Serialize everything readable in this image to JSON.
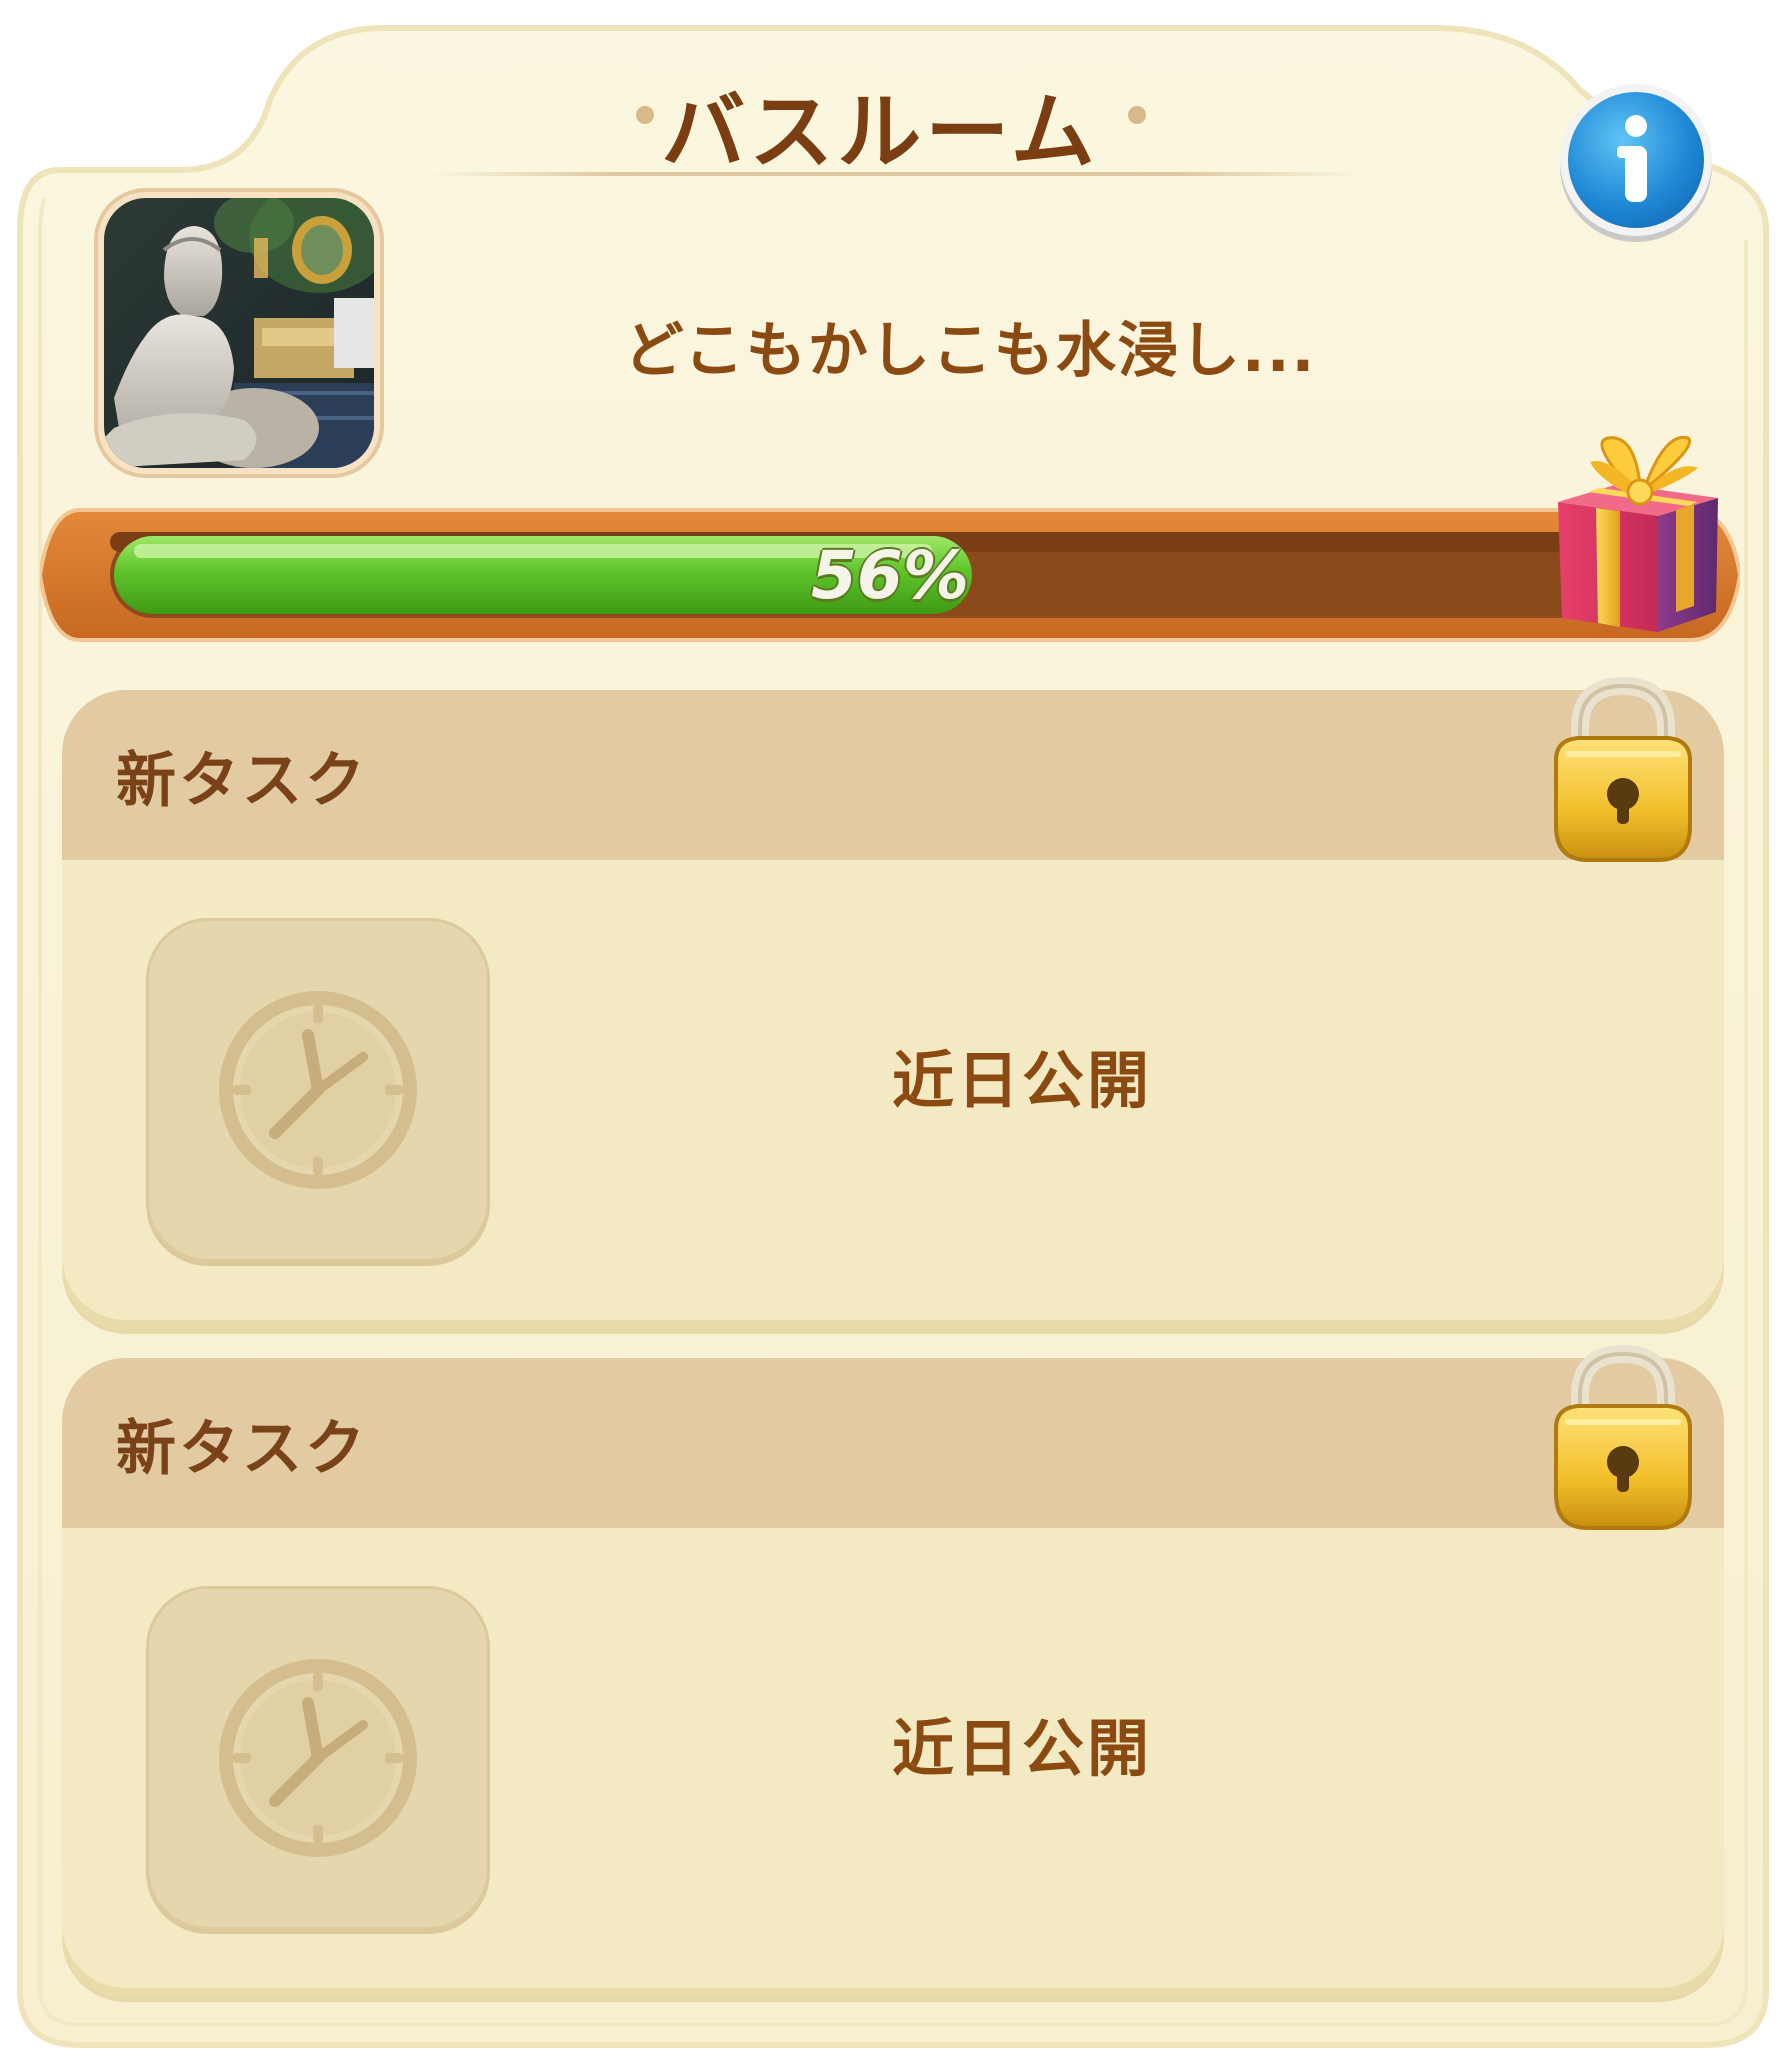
{
  "header": {
    "title": "バスルーム",
    "subtitle": "どこもかしこも水浸し..."
  },
  "icons": {
    "info": "info-icon",
    "thumbnail": "bathroom-scene-thumbnail",
    "gift": "gift-box-icon",
    "lock": "padlock-icon",
    "clock": "clock-icon"
  },
  "progress": {
    "percent": 56,
    "label": "56%"
  },
  "tasks": [
    {
      "title": "新タスク",
      "status": "近日公開",
      "locked": true
    },
    {
      "title": "新タスク",
      "status": "近日公開",
      "locked": true
    }
  ],
  "colors": {
    "panel": "#f8f1d5",
    "bar_fill": "#5ec42a",
    "bar_track": "#8a4a1c",
    "text_brown": "#7a3e12"
  }
}
